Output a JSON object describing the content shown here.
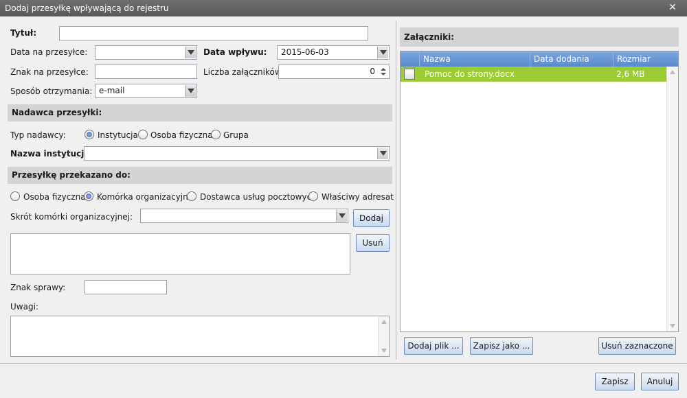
{
  "window": {
    "title": "Dodaj przesyłkę wpływającą do rejestru",
    "close_glyph": "✕"
  },
  "form": {
    "tytul_label": "Tytuł:",
    "tytul_value": "",
    "data_na_przesylce_label": "Data na przesyłce:",
    "data_na_przesylce_value": "",
    "data_wplywu_label": "Data wpływu:",
    "data_wplywu_value": "2015-06-03",
    "znak_label": "Znak na przesyłce:",
    "znak_value": "",
    "liczba_label": "Liczba załączników:",
    "liczba_value": "0",
    "sposob_label": "Sposób otrzymania:",
    "sposob_value": "e-mail"
  },
  "sender": {
    "section_title": "Nadawca przesyłki:",
    "typ_label": "Typ nadawcy:",
    "options": [
      "Instytucja",
      "Osoba fizyczna",
      "Grupa"
    ],
    "selected": "Instytucja",
    "nazwa_label": "Nazwa instytucji:",
    "nazwa_value": ""
  },
  "forward": {
    "section_title": "Przesyłkę przekazano do:",
    "options": [
      "Osoba fizyczna",
      "Komórka organizacyjna",
      "Dostawca usług pocztowych",
      "Właściwy adresat"
    ],
    "selected": "Komórka organizacyjna",
    "skrot_label": "Skrót komórki organizacyjnej:",
    "skrot_value": "",
    "add_label": "Dodaj",
    "remove_label": "Usuń"
  },
  "case": {
    "znak_sprawy_label": "Znak sprawy:",
    "znak_sprawy_value": "",
    "uwagi_label": "Uwagi:",
    "uwagi_value": ""
  },
  "attachments": {
    "section_title": "Załączniki:",
    "columns": [
      "Nazwa",
      "Data dodania",
      "Rozmiar"
    ],
    "rows": [
      {
        "name": "Pomoc do strony.docx",
        "date": "",
        "size": "2,6 MB",
        "checked": false
      }
    ],
    "row_color": "#9ccc35",
    "add_file_label": "Dodaj plik ...",
    "save_as_label": "Zapisz jako ...",
    "remove_selected_label": "Usuń zaznaczone"
  },
  "footer": {
    "save_label": "Zapisz",
    "cancel_label": "Anuluj"
  }
}
